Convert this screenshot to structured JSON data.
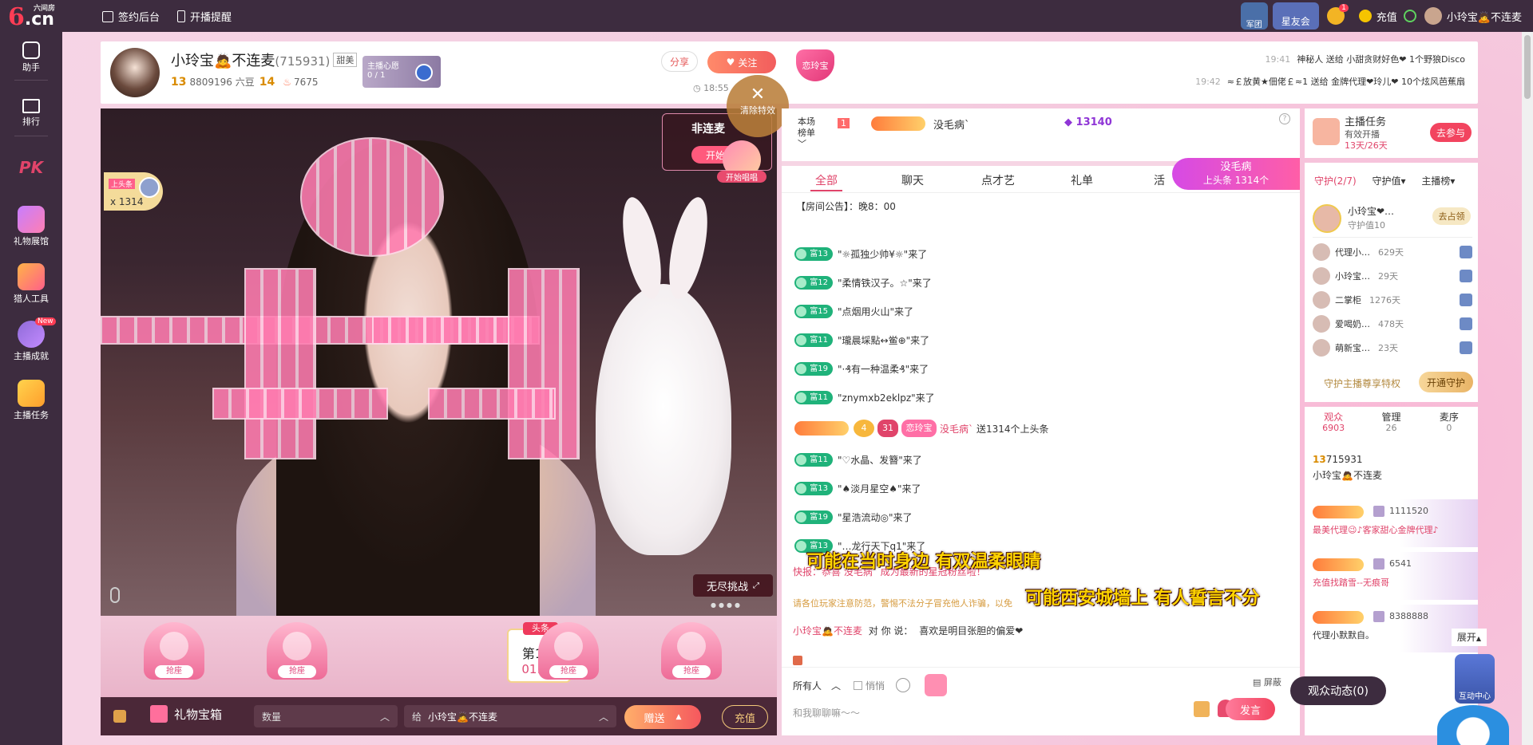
{
  "topbar": {
    "logo_main": "6",
    "logo_cn": ".cn",
    "logo_sub": "六间房",
    "links": [
      "签约后台",
      "开播提醒"
    ],
    "right": {
      "badge1": "军团",
      "badge2": "星友会",
      "bell_count": "1",
      "recharge": "充值",
      "username": "小玲宝🙇不连麦"
    }
  },
  "leftrail": [
    "助手",
    "排行",
    "PK",
    "礼物展馆",
    "猎人工具",
    "主播成就",
    "主播任务"
  ],
  "leftrail_new": "New",
  "streamer": {
    "name": "小玲宝🙇不连麦",
    "id": "(715931)",
    "tag": "甜美",
    "level": "13",
    "beans": "8809196 六豆",
    "level2": "14",
    "fans": "7675",
    "heart_title": "主播心愿",
    "heart_count": "0 / 1",
    "share": "分享",
    "follow": "关注",
    "time": "18:55",
    "badge": "恋玲宝"
  },
  "ticker": [
    {
      "time": "19:41",
      "text": "神秘人 送给 小甜贪财好色❤ 1个野狼Disco"
    },
    {
      "time": "19:42",
      "text": "≈￡放黄★佃佬￡≈1 送给 金牌代理❤玲儿❤ 10个炫风芭蕉扇"
    }
  ],
  "video": {
    "ctrl_title": "非连麦",
    "ctrl_btn": "开始",
    "clear_fx": "清除特效",
    "start_sing": "开始唱唱",
    "top_tag": "上头条",
    "top_count": "x 1314",
    "endless": "无尽挑战"
  },
  "seats": {
    "label": "抢座",
    "rank_tag": "头条",
    "rank_pos": "第1名",
    "rank_time": "01:18"
  },
  "giftbar": {
    "box": "礼物宝箱",
    "qty_placeholder": "数量",
    "to_prefix": "给",
    "to_name": "小玲宝🙇不连麦",
    "send": "赠送",
    "recharge": "充值"
  },
  "chat": {
    "rank_label_1": "本场",
    "rank_label_2": "榜单",
    "rank_num": "1",
    "rank_name": "没毛病`",
    "rank_score": "13140",
    "tabs": [
      "全部",
      "聊天",
      "点才艺",
      "礼单",
      "活"
    ],
    "notice": "【房间公告】：晚8：00",
    "messages": [
      {
        "lv": "富13",
        "text": "\"☼孤独少帅¥☼\"来了"
      },
      {
        "lv": "富12",
        "text": "\"柔情铁汉子。☆\"来了"
      },
      {
        "lv": "富15",
        "text": "\"点烟用火山\"来了"
      },
      {
        "lv": "富11",
        "text": "\"瓏晨埰點↔鲎⊕\"来了"
      },
      {
        "lv": "富19",
        "text": "\"·₰有一种温柔₰\"来了"
      },
      {
        "lv": "富11",
        "text": "\"znymxb2eklpz\"来了"
      },
      {
        "lv": "富11",
        "text": "\"♡水晶、发簪\"来了"
      },
      {
        "lv": "富13",
        "text": "\"♠淡月星空♠\"来了"
      },
      {
        "lv": "富19",
        "text": "\"星浩流动◎\"来了"
      },
      {
        "lv": "富13",
        "text": "\"…龙行天下q1\"来了"
      }
    ],
    "gift_msg": {
      "lv": "4",
      "lv2": "31",
      "badge": "恋玲宝",
      "name": "没毛病`",
      "text": "送1314个上头条"
    },
    "kuaibao": "快报：恭喜 没毛病` 成为最新的星冠粉丝啦！",
    "warning": "请各位玩家注意防范，警惕不法分子冒充他人诈骗，以免",
    "self_msg_name": "小玲宝🙇不连麦",
    "self_msg_mid": "对 你 说：",
    "self_msg_text": "喜欢是明目张胆的偏爱❤",
    "foot_all": "所有人",
    "foot_whisper": "悄悄",
    "foot_screen": "屏蔽",
    "input_placeholder": "和我聊聊嘛～～",
    "send": "发言",
    "toutiao_name": "没毛病",
    "toutiao_text": "上头条 1314个"
  },
  "lyrics": [
    "可能在当时身边  有双温柔眼睛",
    "可能西安城墙上  有人誓言不分"
  ],
  "right": {
    "task_title": "主播任务",
    "task_sub": "有效开播",
    "task_days": "13天/26天",
    "task_btn": "去参与",
    "guard_tabs": [
      "守护(2/7)",
      "守护值▾",
      "主播榜▾"
    ],
    "guard_top_name": "小玲宝❤…",
    "guard_top_val": "守护值10",
    "guard_top_btn": "去占领",
    "guards": [
      {
        "name": "代理小…",
        "days": "629天"
      },
      {
        "name": "小玲宝…",
        "days": "29天"
      },
      {
        "name": "二掌柜",
        "days": "1276天"
      },
      {
        "name": "爱喝奶…",
        "days": "478天"
      },
      {
        "name": "萌新宝…",
        "days": "23天"
      }
    ],
    "priv": "守护主播尊享特权",
    "open_btn": "开通守护",
    "audience": {
      "label": "观众",
      "num": "6903"
    },
    "admin": {
      "label": "管理",
      "num": "26"
    },
    "mic": {
      "label": "麦序",
      "num": "0"
    },
    "self_lv": "13",
    "self_id": "715931",
    "self_name": "小玲宝🙇不连麦",
    "viewers": [
      {
        "id": "1111520",
        "text": "最美代理😉♪客家甜心金牌代理♪"
      },
      {
        "id": "6541",
        "text": "充值找踏雪--无痕哥"
      },
      {
        "id": "8388888",
        "text": "代理小默默自。"
      }
    ],
    "expand": "展开",
    "audience_feed": "观众动态(0)",
    "interact": "互动中心"
  }
}
